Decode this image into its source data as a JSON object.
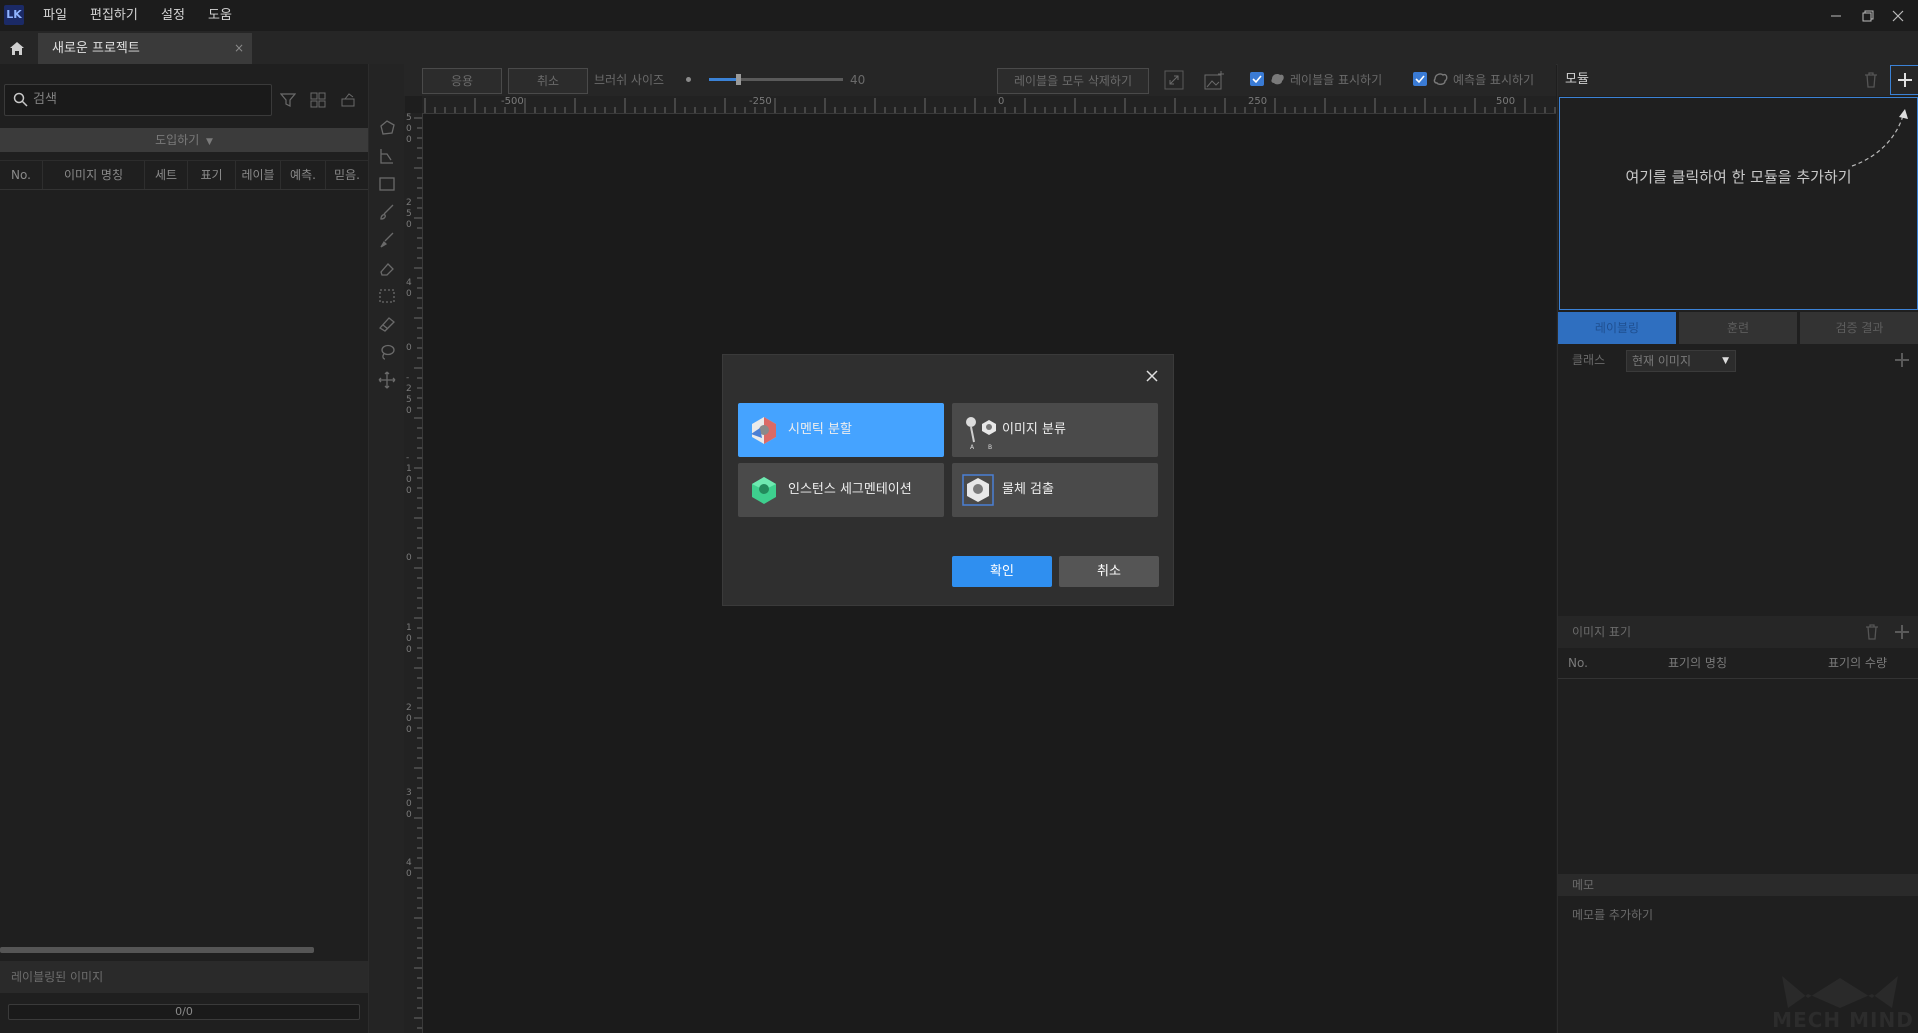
{
  "app": {
    "logo_text": "LK",
    "menu": [
      "파일",
      "편집하기",
      "설정",
      "도움"
    ]
  },
  "tab": {
    "project_name": "새로운 프로젝트",
    "close_glyph": "×"
  },
  "left_panel": {
    "search_placeholder": "검색",
    "import_label": "도입하기",
    "table_columns": [
      "No.",
      "이미지 명칭",
      "세트",
      "표기",
      "레이블",
      "예측.",
      "믿음."
    ],
    "labeled_images_label": "레이블링된 이미지",
    "progress_text": "0/0"
  },
  "toolbar": {
    "apply_label": "응용",
    "cancel_label": "취소",
    "brush_size_label": "브러쉬 사이즈",
    "brush_size_value": "40",
    "brush_size_fraction": 0.22,
    "delete_all_labels_label": "레이블을 모두 삭제하기",
    "show_labels": {
      "label": "레이블을 표시하기",
      "checked": true
    },
    "show_predictions": {
      "label": "예측을 표시하기",
      "checked": true
    }
  },
  "rulers": {
    "top_ticks": [
      "-500",
      "-250",
      "0",
      "250",
      "500"
    ],
    "left_ticks": [
      "5\n0\n0",
      "2\n5\n0",
      "4\n0",
      "0",
      "- \n2\n5\n0",
      "- \n1\n0\n0",
      "0",
      "1\n0\n0",
      "2\n0\n0",
      "3\n0\n0",
      "4\n0"
    ]
  },
  "right_panel": {
    "module_title": "모듈",
    "module_hint": "여기를 클릭하여 한 모듈을 추가하기",
    "tabs": [
      "레이블링",
      "훈련",
      "검증 결과"
    ],
    "class_label": "클래스",
    "class_select_value": "현재 이미지",
    "image_tags_title": "이미지 표기",
    "tags_columns": [
      "No.",
      "표기의 명칭",
      "표기의 수량"
    ],
    "memo_title": "메모",
    "memo_placeholder": "메모를 추가하기",
    "watermark": "MECH MIND"
  },
  "modal": {
    "options": [
      {
        "label": "시멘틱 분할",
        "icon": "semantic-segmentation-icon",
        "selected": true
      },
      {
        "label": "이미지 분류",
        "icon": "image-classification-icon",
        "selected": false
      },
      {
        "label": "인스턴스 세그멘테이션",
        "icon": "instance-segmentation-icon",
        "selected": false
      },
      {
        "label": "물체 검출",
        "icon": "object-detection-icon",
        "selected": false
      }
    ],
    "confirm_label": "확인",
    "cancel_label": "취소"
  },
  "colors": {
    "accent": "#3b82d6",
    "selected_option": "#45a3ff",
    "confirm_button": "#2f8ff0"
  }
}
